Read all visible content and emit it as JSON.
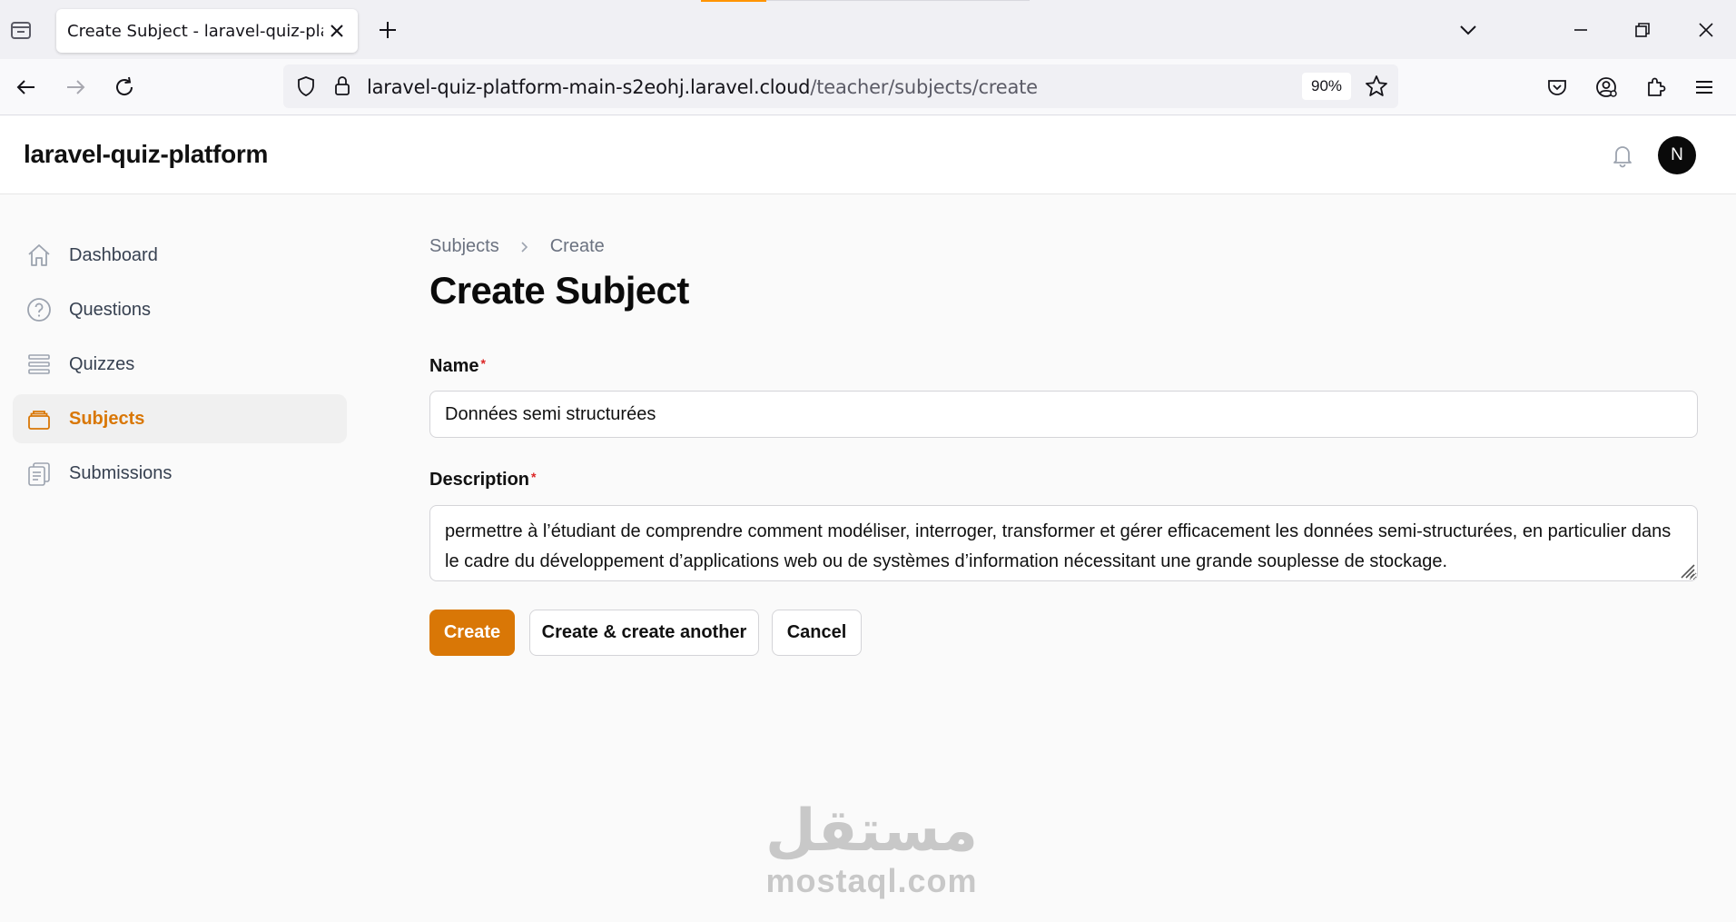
{
  "browser": {
    "tab_title": "Create Subject - laravel-quiz-platform",
    "url_domain": "laravel-quiz-platform-main-s2eohj.laravel.cloud",
    "url_path": "/teacher/subjects/create",
    "zoom": "90%"
  },
  "app": {
    "brand": "laravel-quiz-platform",
    "avatar_initial": "N"
  },
  "sidebar": {
    "items": [
      {
        "label": "Dashboard",
        "icon": "home-icon",
        "active": false
      },
      {
        "label": "Questions",
        "icon": "question-circle-icon",
        "active": false
      },
      {
        "label": "Quizzes",
        "icon": "list-icon",
        "active": false
      },
      {
        "label": "Subjects",
        "icon": "stack-icon",
        "active": true
      },
      {
        "label": "Submissions",
        "icon": "clipboard-icon",
        "active": false
      }
    ]
  },
  "breadcrumb": {
    "parent": "Subjects",
    "current": "Create"
  },
  "page": {
    "title": "Create Subject"
  },
  "form": {
    "name_label": "Name",
    "name_value": "Données semi structurées",
    "description_label": "Description",
    "description_value": "permettre à l’étudiant de comprendre comment modéliser, interroger, transformer et gérer efficacement les données semi-structurées, en particulier dans le cadre du développement d’applications web ou de systèmes d’information nécessitant une grande souplesse de stockage.",
    "required_mark": "*"
  },
  "actions": {
    "create": "Create",
    "create_another": "Create & create another",
    "cancel": "Cancel"
  },
  "watermark": {
    "arabic": "مستقل",
    "latin": "mostaql.com"
  },
  "colors": {
    "accent": "#d97706",
    "firefox_accent": "#ff9400",
    "required": "#dc2626"
  }
}
